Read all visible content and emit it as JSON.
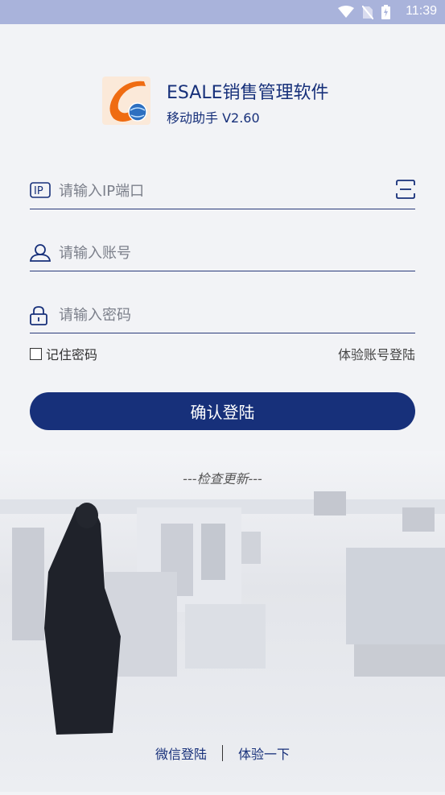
{
  "status_bar": {
    "time": "11:39",
    "icons": [
      "wifi-icon",
      "no-sim-icon",
      "battery-charging-icon"
    ]
  },
  "app": {
    "logo_icon": "esale-logo",
    "title": "ESALE销售管理软件",
    "version": "移动助手 V2.60"
  },
  "form": {
    "ip": {
      "placeholder": "请输入IP端口",
      "value": "",
      "icon": "ip-icon",
      "scan_icon": "scan-icon"
    },
    "account": {
      "placeholder": "请输入账号",
      "value": "",
      "icon": "user-icon"
    },
    "password": {
      "placeholder": "请输入密码",
      "value": "",
      "icon": "lock-icon"
    }
  },
  "remember_label": "记住密码",
  "remember_checked": false,
  "trial_account_label": "体验账号登陆",
  "login_button": "确认登陆",
  "check_update": "---检查更新---",
  "bottom": {
    "wechat_login": "微信登陆",
    "try_it": "体验一下"
  },
  "colors": {
    "primary": "#17307a",
    "status_bar": "#a9b3db"
  }
}
